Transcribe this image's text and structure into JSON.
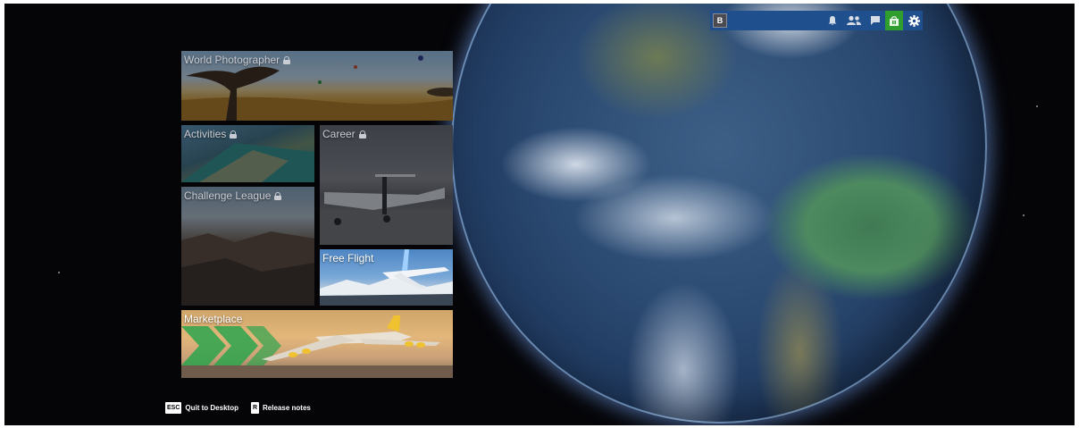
{
  "topbar": {
    "profile_badge": "B",
    "icons": [
      "bell-icon",
      "friends-icon",
      "chat-icon",
      "shop-icon",
      "gear-icon"
    ],
    "colors": {
      "bar": "#1f4f8c",
      "shop": "#2f9e2f"
    }
  },
  "tiles": {
    "world_photographer": "World Photographer",
    "activities": "Activities",
    "career": "Career",
    "challenge_league": "Challenge League",
    "free_flight": "Free Flight",
    "marketplace": "Marketplace"
  },
  "hints": {
    "quit": {
      "key": "ESC",
      "label": "Quit to Desktop"
    },
    "release": {
      "key": "R",
      "label": "Release notes"
    }
  }
}
